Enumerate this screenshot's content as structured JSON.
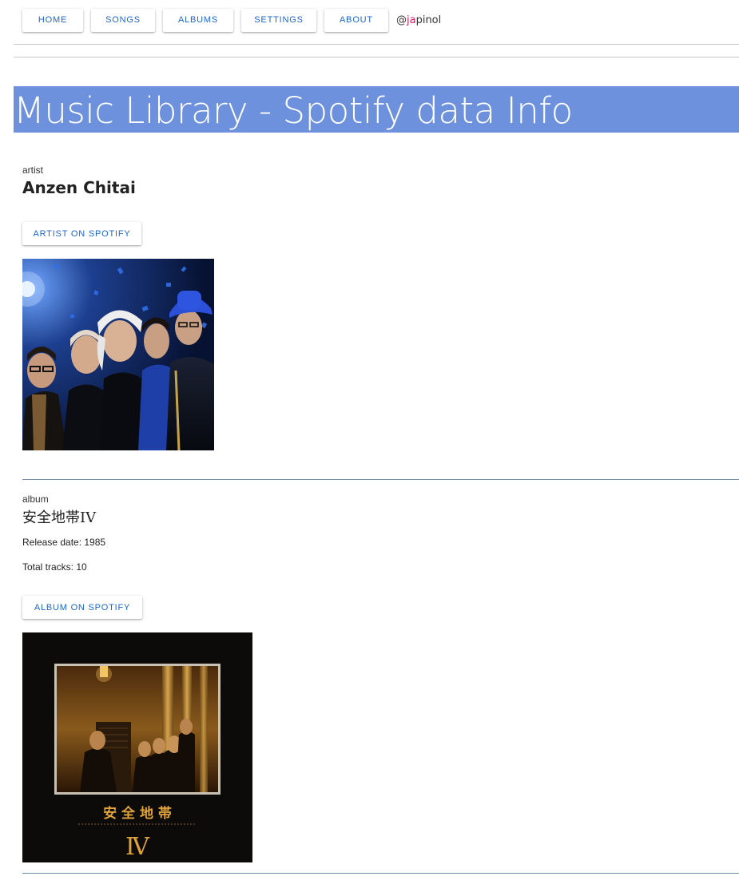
{
  "nav": {
    "items": [
      {
        "label": "HOME"
      },
      {
        "label": "SONGS"
      },
      {
        "label": "ALBUMS"
      },
      {
        "label": "SETTINGS"
      },
      {
        "label": "ABOUT"
      }
    ],
    "brand_prefix": "@",
    "brand_highlight": "ja",
    "brand_suffix": "pinol"
  },
  "page_title": "Music Library - Spotify data Info",
  "artist": {
    "section_label": "artist",
    "name": "Anzen Chitai",
    "spotify_button": "ARTIST ON SPOTIFY"
  },
  "album": {
    "section_label": "album",
    "name": "安全地帯IV",
    "release_date": "Release date: 1985",
    "total_tracks": "Total tracks: 10",
    "spotify_button": "ALBUM ON SPOTIFY",
    "cover_text": "安 全 地 帯",
    "cover_numeral": "Ⅳ"
  },
  "colors": {
    "accent": "#1a67d2",
    "title_bar": "#6e91dd",
    "brand_highlight": "#d81b60",
    "divider": "#6f8ca8"
  }
}
